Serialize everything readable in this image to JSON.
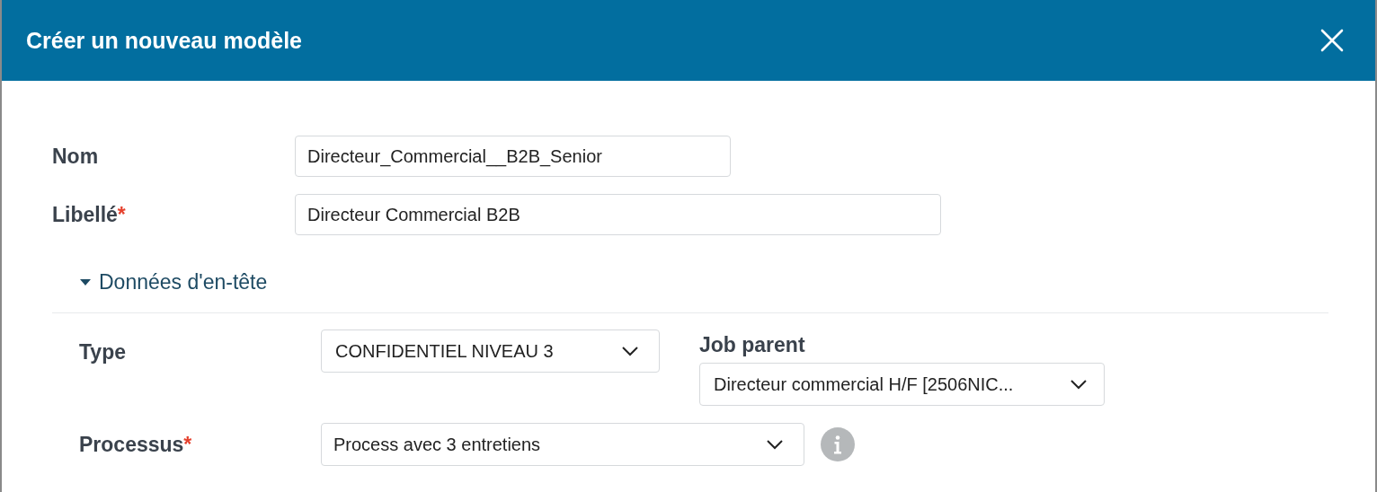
{
  "dialog": {
    "title": "Créer un nouveau modèle"
  },
  "required_mark": "*",
  "fields": [
    {
      "label": "Nom",
      "required": false,
      "value": "Directeur_Commercial__B2B_Senior"
    },
    {
      "label": "Libellé",
      "required": true,
      "value": "Directeur Commercial B2B"
    }
  ],
  "section": {
    "title": "Données d'en-tête",
    "expanded": true,
    "type_field": {
      "label": "Type",
      "value": "CONFIDENTIEL NIVEAU 3"
    },
    "job_parent": {
      "label": "Job parent",
      "value": "Directeur commercial H/F [2506NIC..."
    },
    "processus": {
      "label": "Processus",
      "required": true,
      "value": "Process avec 3 entretiens",
      "info": true
    }
  }
}
